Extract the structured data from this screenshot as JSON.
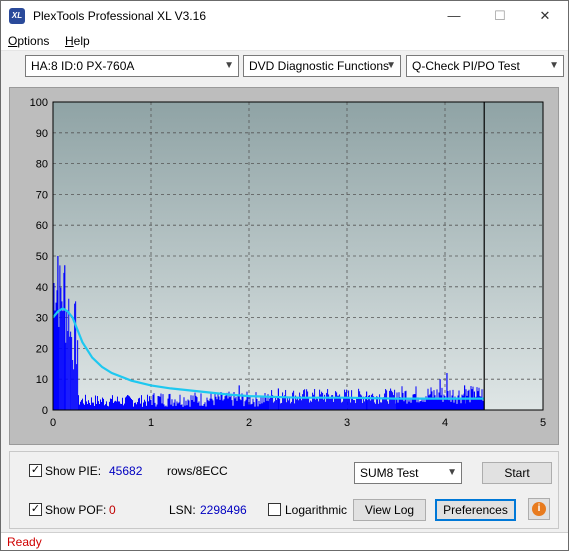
{
  "window": {
    "title": "PlexTools Professional XL V3.16",
    "icon_text": "XL",
    "minimize_glyph": "—",
    "maximize_glyph": "☐",
    "close_glyph": "✕"
  },
  "menu": {
    "options_first": "O",
    "options_rest": "ptions",
    "help_first": "H",
    "help_rest": "elp"
  },
  "toolbar": {
    "drive": "HA:8 ID:0  PX-760A",
    "function": "DVD Diagnostic Functions",
    "test": "Q-Check PI/PO Test"
  },
  "colors": {
    "plot_bg_top": "#8fa3a5",
    "plot_bg_bottom": "#dfe6e6",
    "bars": "#0000ff",
    "trend": "#1ec8f0",
    "status": "#d00000"
  },
  "chart_data": {
    "type": "bar",
    "xlim": [
      0,
      5
    ],
    "ylim": [
      0,
      100
    ],
    "x_ticks": [
      "0",
      "1",
      "2",
      "3",
      "4",
      "5"
    ],
    "y_ticks": [
      "0",
      "10",
      "20",
      "30",
      "40",
      "50",
      "60",
      "70",
      "80",
      "90",
      "100"
    ],
    "grid": true,
    "end_marker_x": 4.4,
    "series": [
      {
        "kind": "bars",
        "segments": [
          {
            "x0": 0.0,
            "x1": 0.05,
            "min": 30,
            "max": 50
          },
          {
            "x0": 0.05,
            "x1": 0.12,
            "min": 25,
            "max": 50
          },
          {
            "x0": 0.12,
            "x1": 0.18,
            "min": 20,
            "max": 44
          },
          {
            "x0": 0.18,
            "x1": 0.26,
            "min": 12,
            "max": 36
          },
          {
            "x0": 0.26,
            "x1": 1.0,
            "min": 1,
            "max": 5
          },
          {
            "x0": 1.0,
            "x1": 2.2,
            "min": 1,
            "max": 6
          },
          {
            "x0": 2.2,
            "x1": 3.5,
            "min": 2,
            "max": 7
          },
          {
            "x0": 3.5,
            "x1": 4.4,
            "min": 2,
            "max": 8
          }
        ],
        "spikes": [
          {
            "x": 0.05,
            "y": 50
          },
          {
            "x": 0.12,
            "y": 47
          },
          {
            "x": 1.9,
            "y": 8
          },
          {
            "x": 2.3,
            "y": 7
          },
          {
            "x": 3.2,
            "y": 6
          },
          {
            "x": 3.95,
            "y": 10
          },
          {
            "x": 4.02,
            "y": 12
          },
          {
            "x": 4.2,
            "y": 8
          },
          {
            "x": 4.3,
            "y": 6
          }
        ]
      },
      {
        "kind": "trend",
        "points": [
          [
            0.0,
            30
          ],
          [
            0.05,
            32
          ],
          [
            0.1,
            33
          ],
          [
            0.15,
            32
          ],
          [
            0.2,
            30
          ],
          [
            0.25,
            26
          ],
          [
            0.3,
            22
          ],
          [
            0.4,
            17
          ],
          [
            0.5,
            14
          ],
          [
            0.6,
            12
          ],
          [
            0.8,
            9.5
          ],
          [
            1.0,
            8
          ],
          [
            1.2,
            7
          ],
          [
            1.5,
            6
          ],
          [
            1.8,
            5
          ],
          [
            2.0,
            4.5
          ],
          [
            2.5,
            4
          ],
          [
            3.0,
            4
          ],
          [
            3.5,
            3.7
          ],
          [
            4.0,
            3.7
          ],
          [
            4.4,
            3.7
          ]
        ]
      }
    ]
  },
  "controls": {
    "show_pie_label": "Show PIE:",
    "show_pie_value": "45682",
    "rows_unit": "rows/8ECC",
    "show_pof_label": "Show POF:",
    "show_pof_value": "0",
    "lsn_label": "LSN:",
    "lsn_value": "2298496",
    "logarithmic_label": "Logarithmic",
    "test_select": "SUM8 Test",
    "start_label": "Start",
    "viewlog_label": "View Log",
    "preferences_label": "Preferences",
    "info_glyph": "i",
    "check_glyph": "✓"
  },
  "status": {
    "text": "Ready"
  }
}
